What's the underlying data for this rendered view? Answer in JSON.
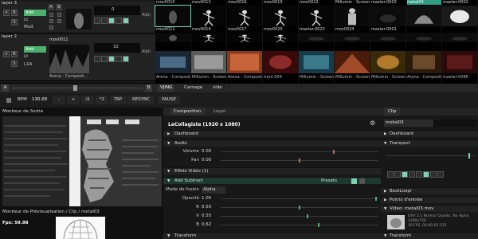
{
  "layers": [
    {
      "name": "layer 3",
      "blend": "Add",
      "options": [
        "Lt",
        "Mult"
      ],
      "counter": "0",
      "alpha": "Alph"
    },
    {
      "name": "layer 2",
      "blend": "Add",
      "options": [
        "Lt",
        "L1A"
      ],
      "counter": "32",
      "alpha": "Alph"
    }
  ],
  "ab_labels": [
    "A",
    "B"
  ],
  "row1_clips": [
    {
      "label": "mov0010",
      "thumb": "dark-figure"
    },
    {
      "label": "mov0013",
      "thumb": "dancer"
    },
    {
      "label": "mov0016",
      "thumb": "dancer"
    },
    {
      "label": "mov0019",
      "thumb": "dancer"
    },
    {
      "label": "mov0022",
      "thumb": "dancer"
    },
    {
      "label": "Millumin - Screen",
      "thumb": "figure"
    },
    {
      "label": "master-0003",
      "thumb": "dark"
    },
    {
      "label": "metal03",
      "thumb": "metal"
    },
    {
      "label": "master-0002",
      "thumb": "white"
    }
  ],
  "row2_clips": [
    {
      "label": "mov0011",
      "thumb": "dark-figure",
      "sublabel": ""
    },
    {
      "label": "mov0014",
      "thumb": "dancer",
      "sublabel": ""
    },
    {
      "label": "mov0017",
      "thumb": "dancer",
      "sublabel": ""
    },
    {
      "label": "mov0020",
      "thumb": "dancer",
      "sublabel": ""
    },
    {
      "label": "master-0023",
      "thumb": "dark",
      "sublabel": ""
    },
    {
      "label": "mov0024",
      "thumb": "dark",
      "sublabel": ""
    },
    {
      "label": "master-0001",
      "thumb": "dark",
      "sublabel": ""
    },
    {
      "label": "",
      "thumb": "dark",
      "sublabel": ""
    },
    {
      "label": "",
      "thumb": "dark",
      "sublabel": ""
    }
  ],
  "row3_clips": [
    {
      "label": "",
      "sublabel": "Arena - Composit...",
      "thumb": "blue"
    },
    {
      "label": "",
      "sublabel": "Millumin - Screen",
      "thumb": "grey"
    },
    {
      "label": "",
      "sublabel": "Arena - Composit...",
      "thumb": "orange"
    },
    {
      "label": "",
      "sublabel": "troni-004",
      "thumb": "red"
    },
    {
      "label": "",
      "sublabel": "Millumin - Screen",
      "thumb": "blue2"
    },
    {
      "label": "",
      "sublabel": "Millumin - Screen",
      "thumb": "red2"
    },
    {
      "label": "",
      "sublabel": "Millumin - Screen",
      "thumb": "amber"
    },
    {
      "label": "",
      "sublabel": "Arena - Composit...",
      "thumb": "brown"
    },
    {
      "label": "",
      "sublabel": "master-0086",
      "thumb": "darkred"
    }
  ],
  "layer2_clip": {
    "label": "mov0011",
    "sublabel": "Arena - Composit..."
  },
  "decks": [
    "VJING",
    "Carnage",
    "vide"
  ],
  "transport": {
    "bpm_label": "BPM",
    "bpm_value": "130.00",
    "minus": "-",
    "plus": "+",
    "div": "/2",
    "mul": "*2",
    "tap": "TAP",
    "resync": "RESYNC",
    "pause": "PAUSE"
  },
  "monitor": {
    "title": "Moniteur de Sortie",
    "preview_title": "Moniteur de Prévisualisation / Clip / metal03",
    "fps": "Fps: 59.98"
  },
  "composition": {
    "tab_composition": "Composition",
    "tab_layer": "Layer",
    "title": "LeCollagiste (1920 x 1080)",
    "sections": {
      "dashboard": "Dashboard",
      "audio": "Audio",
      "effects": "Effets Vidéo (1)",
      "add_subtract": "Add Subtract",
      "transform": "Transform"
    },
    "presets": "Presets",
    "params": [
      {
        "label": "Volume",
        "value": "0.00",
        "pos": 0.72,
        "color": "#e25a5a"
      },
      {
        "label": "Pan",
        "value": "0.00",
        "pos": 0.5,
        "color": "#e25a5a"
      }
    ],
    "blend_label": "Mode de fusion",
    "blend_value": "Alpha",
    "effect_params": [
      {
        "label": "Opacité",
        "value": "1.00",
        "pos": 0.99,
        "color": "#4caf6e"
      },
      {
        "label": "R",
        "value": "0.50",
        "pos": 0.5,
        "color": "#4caf6e"
      },
      {
        "label": "V",
        "value": "0.55",
        "pos": 0.55,
        "color": "#4caf6e"
      },
      {
        "label": "B",
        "value": "0.62",
        "pos": 0.62,
        "color": "#4caf6e"
      }
    ]
  },
  "clip_panel": {
    "tab": "Clip",
    "name": "metal03",
    "sections": {
      "dashboard": "Dashboard",
      "transport": "Transport",
      "beatloopr": "BeatLoopr",
      "cue_points": "Points d'entrée",
      "video": "Video: metal03.mov",
      "transform": "Transform"
    },
    "video_info": [
      "DXV 2.1 Normal Quality, No Alpha",
      "1280x720",
      "30 FPS, 00:00:02:133"
    ]
  },
  "colors": {
    "accent": "#7dd3b0",
    "blend_green": "#4caf6e",
    "highlight_teal": "#2f9c83"
  }
}
